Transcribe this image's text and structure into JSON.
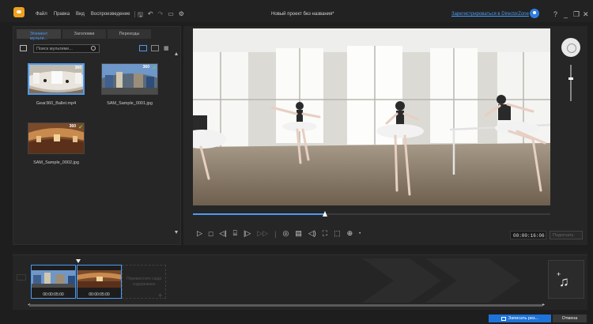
{
  "titlebar": {
    "menu": [
      "Файл",
      "Правка",
      "Вид",
      "Воспроизведение"
    ],
    "project_title": "Новый проект без названия*",
    "register_link": "Зарегистрироваться в DirectorZone",
    "window_controls": [
      "?",
      "_",
      "❐",
      "✕"
    ]
  },
  "media_panel": {
    "tabs": [
      "Элемент мульти...",
      "Заголовки",
      "Переходы"
    ],
    "search_placeholder": "Поиск мультиме...",
    "items": [
      {
        "label": "Gear360_Ballet.mp4",
        "badge": "360",
        "selected": true
      },
      {
        "label": "SAM_Sample_0001.jpg",
        "badge": "360",
        "selected": false
      },
      {
        "label": "SAM_Sample_0002.jpg",
        "badge": "360",
        "selected": false
      }
    ]
  },
  "preview": {
    "timecode": "00:00:16:06",
    "fit_button": "Подогнать",
    "playback_progress": 0.37
  },
  "timeline": {
    "clips": [
      {
        "duration": "00:00:05:00"
      },
      {
        "duration": "00:00:05:00"
      }
    ],
    "drop_hint": "Переместите сюда содержимое"
  },
  "footer": {
    "record_button": "Записать рез...",
    "cancel_button": "Отмена"
  },
  "colors": {
    "accent": "#4a9bf5",
    "logo": "#f0a01e",
    "record_button": "#1e73d9",
    "background": "#1e1e1e"
  }
}
